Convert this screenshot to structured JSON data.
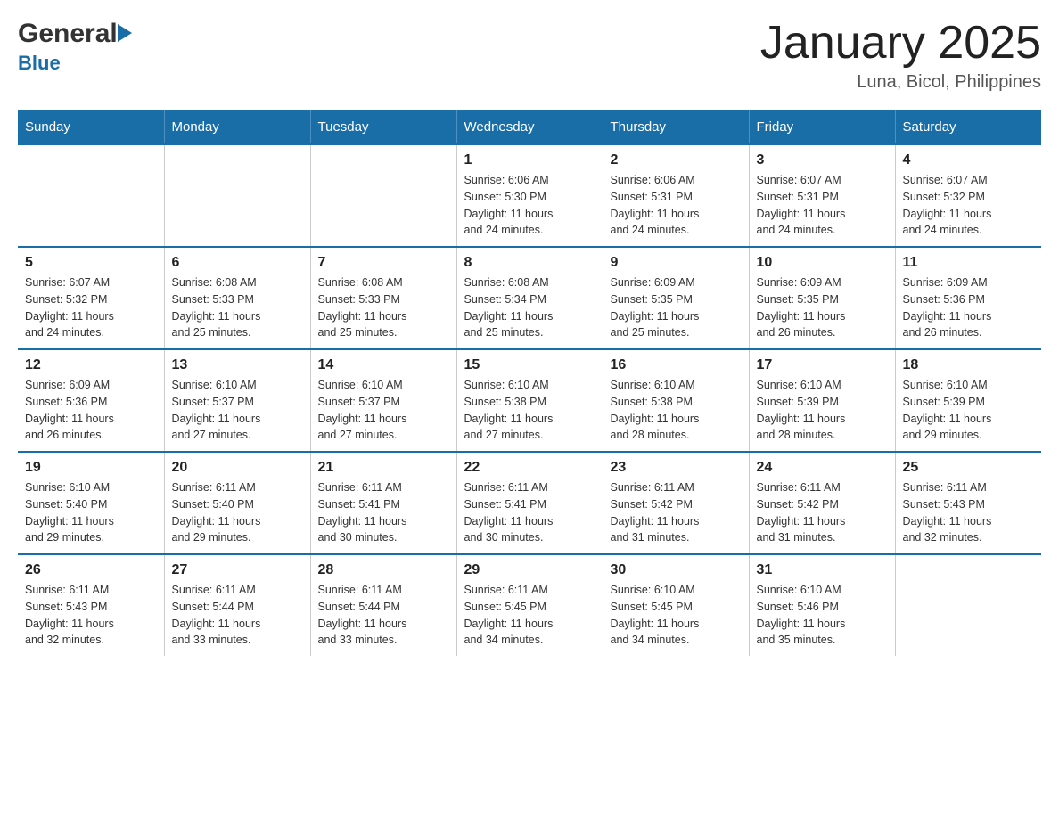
{
  "header": {
    "logo_general": "General",
    "logo_blue": "Blue",
    "month_title": "January 2025",
    "location": "Luna, Bicol, Philippines"
  },
  "days_of_week": [
    "Sunday",
    "Monday",
    "Tuesday",
    "Wednesday",
    "Thursday",
    "Friday",
    "Saturday"
  ],
  "weeks": [
    [
      {
        "day": "",
        "info": ""
      },
      {
        "day": "",
        "info": ""
      },
      {
        "day": "",
        "info": ""
      },
      {
        "day": "1",
        "info": "Sunrise: 6:06 AM\nSunset: 5:30 PM\nDaylight: 11 hours\nand 24 minutes."
      },
      {
        "day": "2",
        "info": "Sunrise: 6:06 AM\nSunset: 5:31 PM\nDaylight: 11 hours\nand 24 minutes."
      },
      {
        "day": "3",
        "info": "Sunrise: 6:07 AM\nSunset: 5:31 PM\nDaylight: 11 hours\nand 24 minutes."
      },
      {
        "day": "4",
        "info": "Sunrise: 6:07 AM\nSunset: 5:32 PM\nDaylight: 11 hours\nand 24 minutes."
      }
    ],
    [
      {
        "day": "5",
        "info": "Sunrise: 6:07 AM\nSunset: 5:32 PM\nDaylight: 11 hours\nand 24 minutes."
      },
      {
        "day": "6",
        "info": "Sunrise: 6:08 AM\nSunset: 5:33 PM\nDaylight: 11 hours\nand 25 minutes."
      },
      {
        "day": "7",
        "info": "Sunrise: 6:08 AM\nSunset: 5:33 PM\nDaylight: 11 hours\nand 25 minutes."
      },
      {
        "day": "8",
        "info": "Sunrise: 6:08 AM\nSunset: 5:34 PM\nDaylight: 11 hours\nand 25 minutes."
      },
      {
        "day": "9",
        "info": "Sunrise: 6:09 AM\nSunset: 5:35 PM\nDaylight: 11 hours\nand 25 minutes."
      },
      {
        "day": "10",
        "info": "Sunrise: 6:09 AM\nSunset: 5:35 PM\nDaylight: 11 hours\nand 26 minutes."
      },
      {
        "day": "11",
        "info": "Sunrise: 6:09 AM\nSunset: 5:36 PM\nDaylight: 11 hours\nand 26 minutes."
      }
    ],
    [
      {
        "day": "12",
        "info": "Sunrise: 6:09 AM\nSunset: 5:36 PM\nDaylight: 11 hours\nand 26 minutes."
      },
      {
        "day": "13",
        "info": "Sunrise: 6:10 AM\nSunset: 5:37 PM\nDaylight: 11 hours\nand 27 minutes."
      },
      {
        "day": "14",
        "info": "Sunrise: 6:10 AM\nSunset: 5:37 PM\nDaylight: 11 hours\nand 27 minutes."
      },
      {
        "day": "15",
        "info": "Sunrise: 6:10 AM\nSunset: 5:38 PM\nDaylight: 11 hours\nand 27 minutes."
      },
      {
        "day": "16",
        "info": "Sunrise: 6:10 AM\nSunset: 5:38 PM\nDaylight: 11 hours\nand 28 minutes."
      },
      {
        "day": "17",
        "info": "Sunrise: 6:10 AM\nSunset: 5:39 PM\nDaylight: 11 hours\nand 28 minutes."
      },
      {
        "day": "18",
        "info": "Sunrise: 6:10 AM\nSunset: 5:39 PM\nDaylight: 11 hours\nand 29 minutes."
      }
    ],
    [
      {
        "day": "19",
        "info": "Sunrise: 6:10 AM\nSunset: 5:40 PM\nDaylight: 11 hours\nand 29 minutes."
      },
      {
        "day": "20",
        "info": "Sunrise: 6:11 AM\nSunset: 5:40 PM\nDaylight: 11 hours\nand 29 minutes."
      },
      {
        "day": "21",
        "info": "Sunrise: 6:11 AM\nSunset: 5:41 PM\nDaylight: 11 hours\nand 30 minutes."
      },
      {
        "day": "22",
        "info": "Sunrise: 6:11 AM\nSunset: 5:41 PM\nDaylight: 11 hours\nand 30 minutes."
      },
      {
        "day": "23",
        "info": "Sunrise: 6:11 AM\nSunset: 5:42 PM\nDaylight: 11 hours\nand 31 minutes."
      },
      {
        "day": "24",
        "info": "Sunrise: 6:11 AM\nSunset: 5:42 PM\nDaylight: 11 hours\nand 31 minutes."
      },
      {
        "day": "25",
        "info": "Sunrise: 6:11 AM\nSunset: 5:43 PM\nDaylight: 11 hours\nand 32 minutes."
      }
    ],
    [
      {
        "day": "26",
        "info": "Sunrise: 6:11 AM\nSunset: 5:43 PM\nDaylight: 11 hours\nand 32 minutes."
      },
      {
        "day": "27",
        "info": "Sunrise: 6:11 AM\nSunset: 5:44 PM\nDaylight: 11 hours\nand 33 minutes."
      },
      {
        "day": "28",
        "info": "Sunrise: 6:11 AM\nSunset: 5:44 PM\nDaylight: 11 hours\nand 33 minutes."
      },
      {
        "day": "29",
        "info": "Sunrise: 6:11 AM\nSunset: 5:45 PM\nDaylight: 11 hours\nand 34 minutes."
      },
      {
        "day": "30",
        "info": "Sunrise: 6:10 AM\nSunset: 5:45 PM\nDaylight: 11 hours\nand 34 minutes."
      },
      {
        "day": "31",
        "info": "Sunrise: 6:10 AM\nSunset: 5:46 PM\nDaylight: 11 hours\nand 35 minutes."
      },
      {
        "day": "",
        "info": ""
      }
    ]
  ]
}
